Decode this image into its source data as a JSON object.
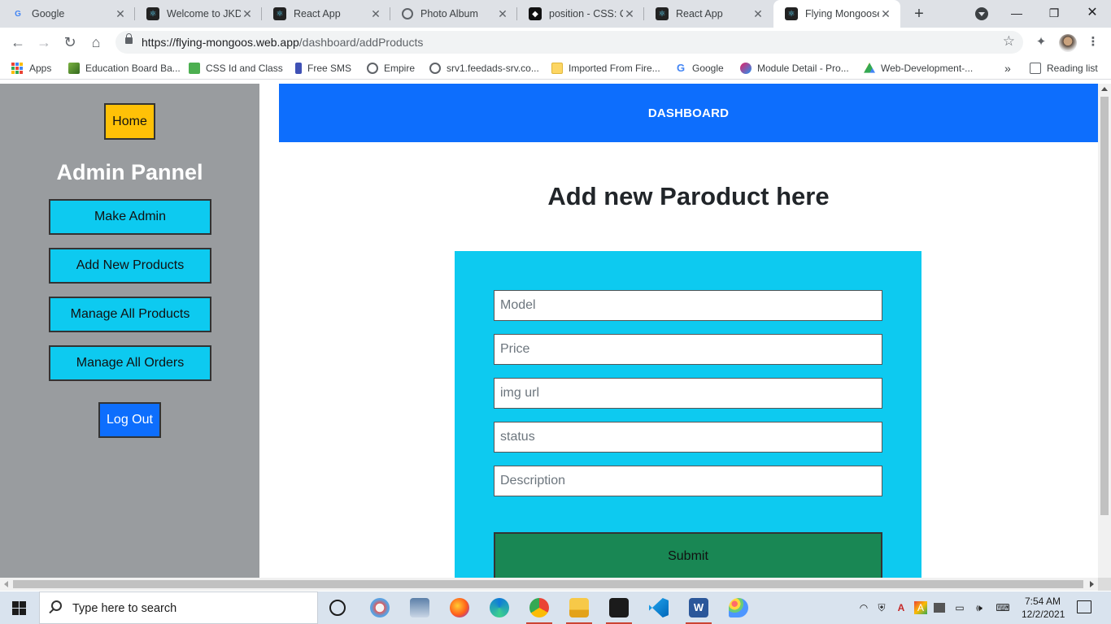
{
  "browser": {
    "tabs": [
      {
        "title": "Google",
        "icon": "google-icon",
        "active": false
      },
      {
        "title": "Welcome to JKD's",
        "icon": "react-icon",
        "active": false
      },
      {
        "title": "React App",
        "icon": "react-icon",
        "active": false
      },
      {
        "title": "Photo Album",
        "icon": "globe-icon",
        "active": false
      },
      {
        "title": "position - CSS: Ca",
        "icon": "codepen-icon",
        "active": false
      },
      {
        "title": "React App",
        "icon": "react-icon",
        "active": false
      },
      {
        "title": "Flying Mongoose",
        "icon": "react-icon",
        "active": true
      }
    ],
    "url_host": "https://flying-mongoos.web.app",
    "url_path": "/dashboard/addProducts",
    "bookmarks": [
      "Apps",
      "Education Board Ba...",
      "CSS Id and Class",
      "Free SMS",
      "Empire",
      "srv1.feedads-srv.co...",
      "Imported From Fire...",
      "Google",
      "Module Detail - Pro...",
      "Web-Development-..."
    ],
    "bookmarks_overflow": "»",
    "reading_list": "Reading list"
  },
  "sidebar": {
    "home_label": "Home",
    "title": "Admin Pannel",
    "items": [
      {
        "label": "Make Admin"
      },
      {
        "label": "Add New Products"
      },
      {
        "label": "Manage All Products"
      },
      {
        "label": "Manage All Orders"
      }
    ],
    "logout_label": "Log Out"
  },
  "header": {
    "title": "DASHBOARD"
  },
  "main": {
    "title": "Add new Paroduct here",
    "fields": [
      {
        "placeholder": "Model"
      },
      {
        "placeholder": "Price"
      },
      {
        "placeholder": "img url"
      },
      {
        "placeholder": "status"
      },
      {
        "placeholder": "Description"
      }
    ],
    "submit_label": "Submit"
  },
  "taskbar": {
    "search_placeholder": "Type here to search",
    "time": "7:54 AM",
    "date": "12/2/2021"
  },
  "colors": {
    "primary": "#0d6efd",
    "info": "#0dcaf0",
    "warning": "#ffc107",
    "success": "#198754",
    "sidebar_bg": "#999c9f"
  }
}
